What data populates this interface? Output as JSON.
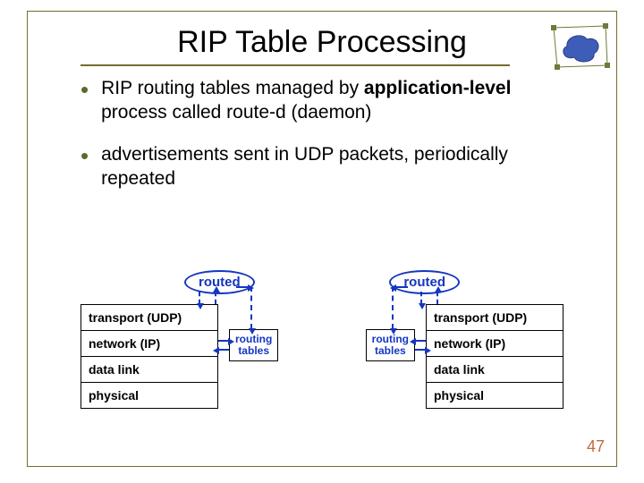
{
  "title": "RIP Table Processing",
  "bullets": [
    {
      "pre": "RIP routing tables managed by ",
      "bold": "application-level",
      "post": " process called route-d (daemon)"
    },
    {
      "pre": "advertisements sent in UDP packets, periodically repeated",
      "bold": "",
      "post": ""
    }
  ],
  "diagram": {
    "routed_label": "routed",
    "routing_tables_label_1": "routing",
    "routing_tables_label_2": "tables",
    "layers": [
      "transport (UDP)",
      "network (IP)",
      "data link",
      "physical"
    ]
  },
  "slide_number": "47"
}
